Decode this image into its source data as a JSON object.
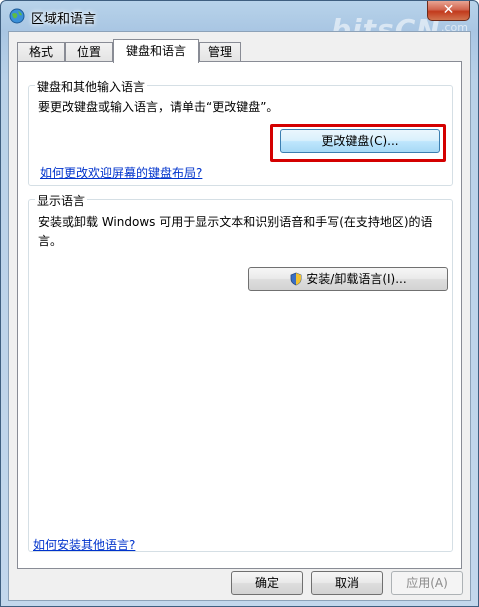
{
  "window": {
    "title": "区域和语言",
    "close_label": "✕",
    "watermark": "bitsCN",
    "watermark_sub": ".com"
  },
  "tabs": [
    {
      "label": "格式"
    },
    {
      "label": "位置"
    },
    {
      "label": "键盘和语言",
      "active": true
    },
    {
      "label": "管理"
    }
  ],
  "keyboard_group": {
    "title": "键盘和其他输入语言",
    "description": "要更改键盘或输入语言，请单击“更改键盘”。",
    "change_button": "更改键盘(C)...",
    "link": "如何更改欢迎屏幕的键盘布局?"
  },
  "display_group": {
    "title": "显示语言",
    "description_line1": "安装或卸载 Windows 可用于显示文本和识别语音和手写(在支持地区)的语",
    "description_line2": "言。",
    "install_button": "安装/卸载语言(I)..."
  },
  "footer": {
    "link": "如何安装其他语言?",
    "ok": "确定",
    "cancel": "取消",
    "apply": "应用(A)"
  },
  "colors": {
    "accent_red": "#d40000",
    "link_blue": "#0033cc"
  },
  "icons": [
    "globe-icon",
    "close-icon",
    "shield-icon"
  ]
}
